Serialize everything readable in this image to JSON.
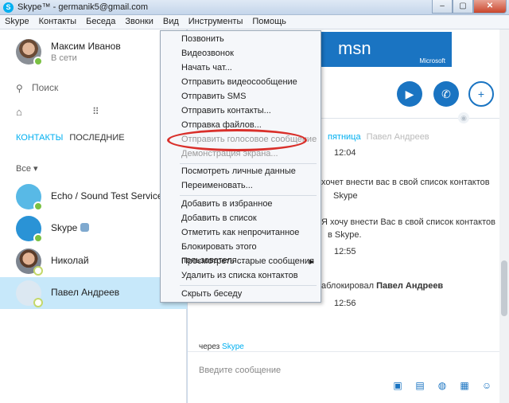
{
  "window": {
    "title": "Skype™ - germanik5@gmail.com",
    "app_icon": "skype-icon",
    "controls": [
      "–",
      "▢",
      "✕"
    ]
  },
  "menubar": [
    "Skype",
    "Контакты",
    "Беседа",
    "Звонки",
    "Вид",
    "Инструменты",
    "Помощь"
  ],
  "profile": {
    "name": "Максим Иванов",
    "status": "В сети"
  },
  "search": {
    "placeholder": "Поиск"
  },
  "tabs": {
    "contacts": "КОНТАКТЫ",
    "recent": "ПОСЛЕДНИЕ"
  },
  "filter": {
    "label": "Все ▾"
  },
  "contacts": [
    {
      "name": "Echo / Sound Test Service"
    },
    {
      "name": "Skype"
    },
    {
      "name": "Николай"
    },
    {
      "name": "Павел Андреев"
    }
  ],
  "banner": {
    "logo": "msn",
    "brand": "Microsoft"
  },
  "chat": {
    "day": "пятница",
    "ghost_name": "Павел Андреев",
    "time1": "12:04",
    "msg1_line1": "хочет внести вас в свой список контактов",
    "msg1_line2": "Skype",
    "msg2_line1": "Я хочу внести Вас в свой список контактов",
    "msg2_line2": "в Skype.",
    "time2": "12:55",
    "msg3_prefix": "аблокировал",
    "msg3_name": "Павел Андреев",
    "time3": "12:56",
    "via_prefix": "через",
    "via_link": "Skype",
    "compose_placeholder": "Введите сообщение"
  },
  "context_menu": {
    "items": [
      "Позвонить",
      "Видеозвонок",
      "Начать чат...",
      "Отправить видеосообщение",
      "Отправить SMS",
      "Отправить контакты...",
      "Отправка файлов...",
      "Отправить голосовое сообщение",
      "Демонстрация экрана...",
      "Посмотреть личные данные",
      "Переименовать...",
      "Добавить в избранное",
      "Добавить в список",
      "Отметить как непрочитанное",
      "Блокировать этого пользователя...",
      "Просмотреть старые сообщения",
      "Удалить из списка контактов",
      "Скрыть беседу"
    ],
    "submenu_arrow": "▶"
  },
  "colors": {
    "accent": "#00aff0",
    "brand_blue": "#1a74c2",
    "highlight_red": "#d9302b",
    "online_green": "#7ac143"
  }
}
